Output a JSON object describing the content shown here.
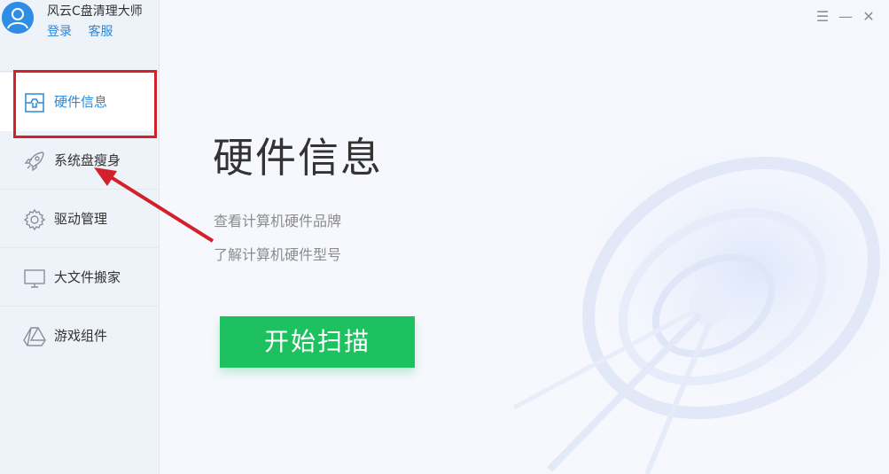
{
  "app": {
    "title": "风云C盘清理大师",
    "links": {
      "login": "登录",
      "support": "客服"
    }
  },
  "sidebar": {
    "items": [
      {
        "label": "硬件信息",
        "icon": "hardware-icon",
        "active": true
      },
      {
        "label": "系统盘瘦身",
        "icon": "rocket-icon",
        "active": false
      },
      {
        "label": "驱动管理",
        "icon": "gear-icon",
        "active": false
      },
      {
        "label": "大文件搬家",
        "icon": "monitor-icon",
        "active": false
      },
      {
        "label": "游戏组件",
        "icon": "drive-triangle-icon",
        "active": false
      }
    ]
  },
  "window_controls": {
    "menu": "☰",
    "minimize": "—",
    "close": "✕"
  },
  "main": {
    "title": "硬件信息",
    "descriptions": [
      "查看计算机硬件品牌",
      "了解计算机硬件型号"
    ],
    "scan_button": "开始扫描"
  },
  "colors": {
    "accent": "#2b88d8",
    "scan_button": "#1ec15f",
    "highlight": "#d3212b"
  }
}
